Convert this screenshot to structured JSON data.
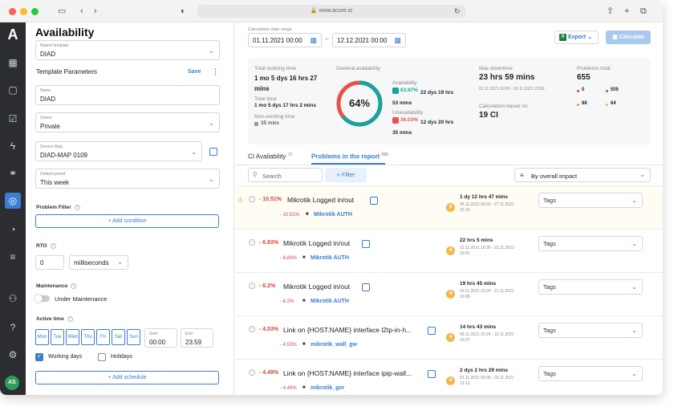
{
  "browser": {
    "url": "www.acure.io"
  },
  "sidebar": {
    "logo": "A",
    "avatar": "AS"
  },
  "left": {
    "title": "Availability",
    "report_template": {
      "label": "Report template",
      "value": "DIAD"
    },
    "template_params": {
      "title": "Template Parameters",
      "save": "Save"
    },
    "name": {
      "label": "Name",
      "value": "DIAD"
    },
    "owner": {
      "label": "Owner",
      "value": "Private"
    },
    "service_map": {
      "label": "Service Map",
      "value": "DIAD-MAP 0109"
    },
    "default_period": {
      "label": "Default period",
      "value": "This week"
    },
    "problem_filter": {
      "title": "Problem Filter",
      "add": "+ Add condition"
    },
    "rto": {
      "title": "RTO",
      "value": "0",
      "unit": "milliseconds"
    },
    "maintenance": {
      "title": "Maintenance",
      "toggle_label": "Under Maintenance",
      "enabled": false
    },
    "active_time": {
      "title": "Active time",
      "days": [
        "Mon",
        "Tue",
        "Wed",
        "Thu",
        "Fri",
        "Sat",
        "Sun"
      ],
      "start_label": "Start",
      "start": "00:00",
      "end_label": "End",
      "end": "23:59",
      "working_days": "Working days",
      "holidays": "Holidays",
      "add_schedule": "+ Add schedule"
    }
  },
  "top": {
    "range_label": "Calculation date range",
    "from": "01.11.2021 00:00",
    "to": "12.12.2021 00:00",
    "export": "Export",
    "calculate": "Calculate"
  },
  "stats": {
    "total_working_label": "Total working time",
    "total_working_value": "1 mo 5 dys 16 hrs 27 mins",
    "total_time_label": "Total time",
    "total_time_value": "1 mo 5 dys 17 hrs 2 mins",
    "nonworking_label": "Non-working time",
    "nonworking_value": "35 mins",
    "general_label": "General availability",
    "donut_value": "64%",
    "availability_label": "Availability",
    "availability_pct": "63.97%",
    "availability_time": "22 dys 19 hrs 53 mins",
    "unavailability_label": "Unavailability",
    "unavailability_pct": "36.03%",
    "unavailability_time": "12 dys 20 hrs 35 mins",
    "max_downtime_label": "Max downtime",
    "max_downtime_value": "23 hrs 59 mins",
    "max_downtime_dates": "02.11.2021 00:00 - 02.11.2021 23:59",
    "calc_based_label": "Calculation based on",
    "calc_based_value": "19 CI",
    "problems_total_label": "Problems total",
    "problems_total_value": "655",
    "counts": [
      {
        "value": "0",
        "color": "#d9433d"
      },
      {
        "value": "505",
        "color": "#d9433d"
      },
      {
        "value": "86",
        "color": "#f08a3c"
      },
      {
        "value": "64",
        "color": "#f2b84b"
      }
    ],
    "availability_fraction": 0.6397
  },
  "tabs": [
    {
      "label": "CI Availability",
      "count": "19"
    },
    {
      "label": "Problems in the report",
      "count": "655"
    }
  ],
  "filterbar": {
    "search_placeholder": "Search",
    "filter": "+ Filter",
    "sort": "By overall impact"
  },
  "rows": [
    {
      "pct": "- 10.51%",
      "title": "Mikrotik Logged in/out",
      "pct2": "- 10.51%",
      "sub": "Mikrotik AUTH",
      "badge": "4",
      "dur": "1 dy 12 hrs 47 mins",
      "dates": "26.11.2021 09:26 - 27.11.2021 22:13",
      "tags": "Tags",
      "warn": true
    },
    {
      "pct": "- 6.83%",
      "title": "Mikrotik Logged in/out",
      "pct2": "- 6.83%",
      "sub": "Mikrotik AUTH",
      "badge": "4",
      "dur": "22 hrs 5 mins",
      "dates": "21.11.2021 18:36 - 22.11.2021 16:41",
      "tags": "Tags",
      "warn": false
    },
    {
      "pct": "- 6.2%",
      "title": "Mikrotik Logged in/out",
      "pct2": "- 6.2%",
      "sub": "Mikrotik AUTH",
      "badge": "4",
      "dur": "19 hrs 45 mins",
      "dates": "20.11.2021 19:24 - 21.11.2021 15:08",
      "tags": "Tags",
      "warn": false
    },
    {
      "pct": "- 4.53%",
      "title": "Link on {HOST.NAME} interface l2tp-in-h...",
      "pct2": "- 4.53%",
      "sub": "mikrotik_wall_gw",
      "badge": "4",
      "dur": "14 hrs 43 mins",
      "dates": "09.11.2021 22:24 - 10.11.2021 13:07",
      "tags": "Tags",
      "warn": false
    },
    {
      "pct": "- 4.49%",
      "title": "Link on {HOST.NAME} interface ipip-wall...",
      "pct2": "- 4.49%",
      "sub": "mikrotik_gor",
      "badge": "4",
      "dur": "2 dys 2 hrs 29 mins",
      "dates": "01.11.2021 00:00 - 03.11.2021 12:10",
      "tags": "Tags",
      "warn": false
    }
  ]
}
